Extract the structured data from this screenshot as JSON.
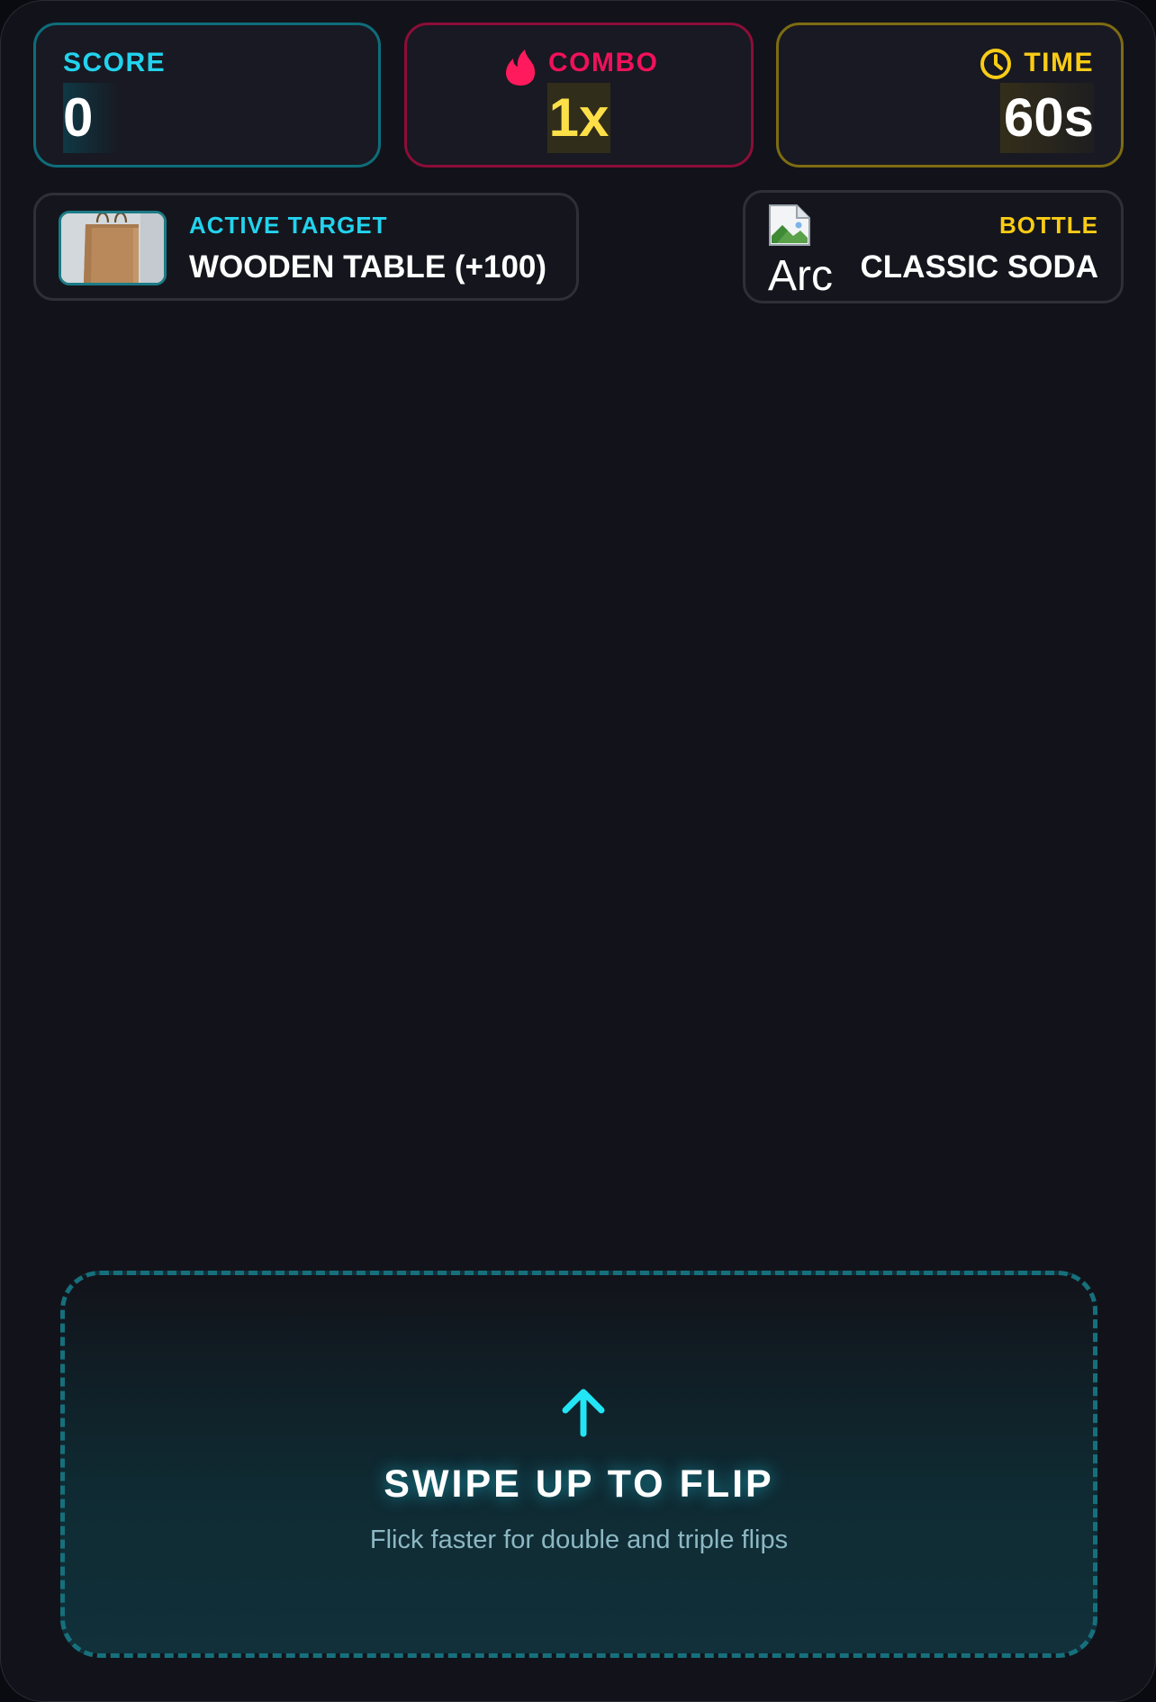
{
  "hud": {
    "score": {
      "label": "SCORE",
      "value": "0"
    },
    "combo": {
      "label": "COMBO",
      "value": "1x"
    },
    "time": {
      "label": "TIME",
      "value": "60s"
    }
  },
  "target": {
    "label": "ACTIVE TARGET",
    "name": "WOODEN TABLE (+100)",
    "thumbnail_icon": "paper-bag-image"
  },
  "bottle": {
    "label": "BOTTLE",
    "name": "CLASSIC SODA",
    "image_alt": "Arc",
    "image_icon": "broken-image-icon"
  },
  "swipe": {
    "icon": "arrow-up-icon",
    "title": "SWIPE UP TO FLIP",
    "subtitle": "Flick faster for double and triple flips"
  },
  "colors": {
    "background": "#12131a",
    "cyan_accent": "#22d3ee",
    "pink_accent": "#f0115a",
    "yellow_accent": "#facc15",
    "combo_value": "#fde047"
  }
}
